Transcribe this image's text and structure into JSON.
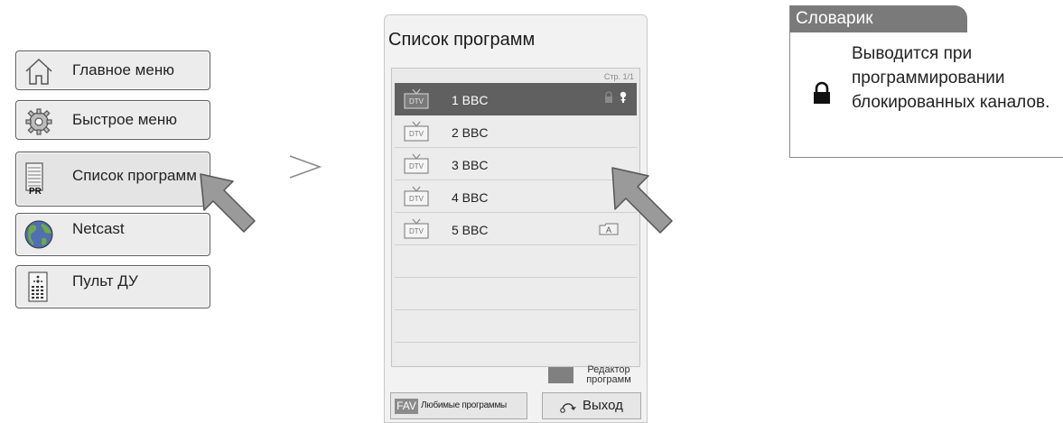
{
  "menu": {
    "items": [
      {
        "label": "Главное меню",
        "icon": "home-icon"
      },
      {
        "label": "Быстрое меню",
        "icon": "gears-icon"
      },
      {
        "label": "Список программ",
        "icon": "program-list-icon",
        "icon_text": "PR"
      },
      {
        "label": "Netcast",
        "icon": "globe-icon"
      },
      {
        "label": "Пульт ДУ",
        "icon": "remote-control-icon"
      }
    ]
  },
  "panel": {
    "title": "Список программ",
    "page_indicator": "Стр. 1/1",
    "channels": [
      {
        "badge": "DTV",
        "name": "1 BBC",
        "selected": true
      },
      {
        "badge": "DTV",
        "name": "2 BBC"
      },
      {
        "badge": "DTV",
        "name": "3 BBC"
      },
      {
        "badge": "DTV",
        "name": "4 BBC"
      },
      {
        "badge": "DTV",
        "name": "5 BBC",
        "extra_badge": "A"
      }
    ],
    "legend": "Редактор программ",
    "fav_tag": "FAV",
    "fav_label": "Любимые программы",
    "exit_label": "Выход"
  },
  "glossary": {
    "title": "Словарик",
    "text": "Выводится при программировании блокированных каналов."
  },
  "colors": {
    "selected_row": "#606060",
    "glossary_tab": "#7a7a7a",
    "cursor": "#9a9a9a"
  }
}
